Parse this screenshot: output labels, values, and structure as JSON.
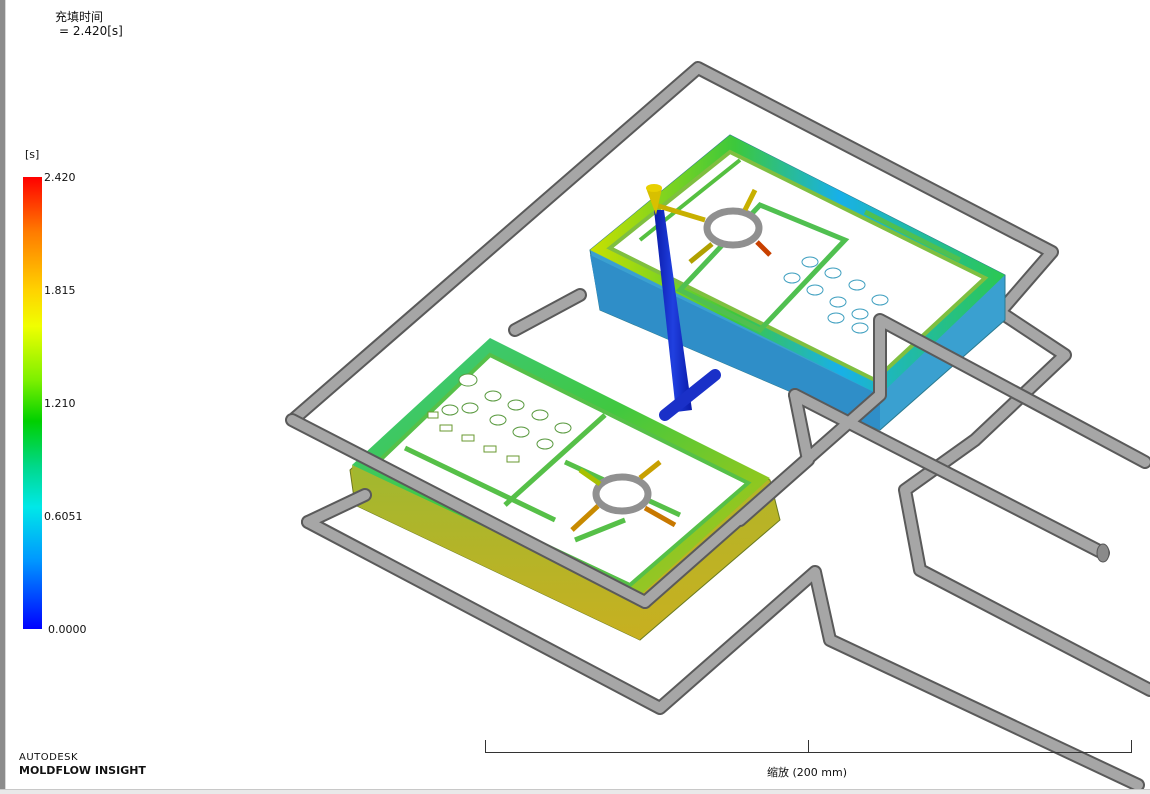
{
  "result": {
    "title": "充填时间",
    "value_line": "= 2.420[s]"
  },
  "legend": {
    "unit": "[s]",
    "ticks": [
      "2.420",
      "1.815",
      "1.210",
      "0.6051",
      "0.0000"
    ],
    "min": 0.0,
    "max": 2.42,
    "colors": {
      "max": "#ff0000",
      "mid": "#00d000",
      "min": "#0000ff"
    }
  },
  "scale": {
    "label": "缩放 (200 mm)"
  },
  "branding": {
    "company": "AUTODESK",
    "product": "MOLDFLOW INSIGHT"
  },
  "model": {
    "part_color_scheme": "fill-time",
    "cooling_lines_color": "#9a9a9a",
    "sprue_color": "#1428c8"
  }
}
